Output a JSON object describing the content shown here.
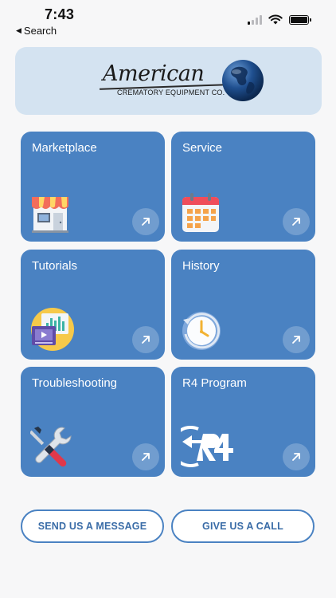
{
  "status": {
    "time": "7:43",
    "back_label": "Search"
  },
  "brand": {
    "word": "American",
    "sub": "CREMATORY EQUIPMENT CO."
  },
  "cards": [
    {
      "title": "Marketplace",
      "icon": "storefront-icon"
    },
    {
      "title": "Service",
      "icon": "calendar-icon"
    },
    {
      "title": "Tutorials",
      "icon": "video-tutorial-icon"
    },
    {
      "title": "History",
      "icon": "clock-history-icon"
    },
    {
      "title": "Troubleshooting",
      "icon": "tools-icon"
    },
    {
      "title": "R4 Program",
      "icon": "r4-logo-icon"
    }
  ],
  "actions": {
    "message": "SEND US A MESSAGE",
    "call": "GIVE US A CALL"
  },
  "colors": {
    "card": "#4a82c2",
    "banner": "#d4e3f1",
    "accent_text": "#3a6ca7"
  }
}
